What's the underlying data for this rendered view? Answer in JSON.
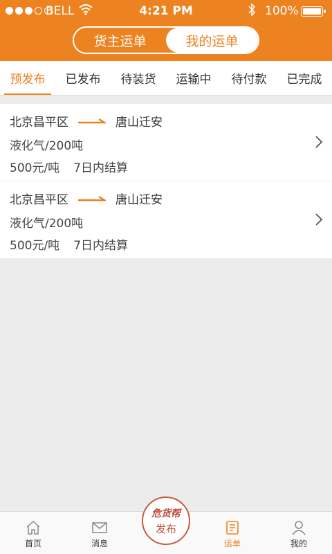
{
  "status_bar": {
    "carrier": "BELL",
    "time": "4:21 PM",
    "battery": "100%",
    "battery_level": 1.0
  },
  "header": {
    "segments": [
      {
        "label": "货主运单",
        "active": false
      },
      {
        "label": "我的运单",
        "active": true
      }
    ]
  },
  "tabs": [
    {
      "label": "预发布",
      "active": true
    },
    {
      "label": "已发布",
      "active": false
    },
    {
      "label": "待装货",
      "active": false
    },
    {
      "label": "运输中",
      "active": false
    },
    {
      "label": "待付款",
      "active": false
    },
    {
      "label": "已完成",
      "active": false
    }
  ],
  "orders": [
    {
      "from": "北京昌平区",
      "to": "唐山迁安",
      "cargo": "液化气/200吨",
      "price": "500元/吨",
      "settlement": "7日内结算"
    },
    {
      "from": "北京昌平区",
      "to": "唐山迁安",
      "cargo": "液化气/200吨",
      "price": "500元/吨",
      "settlement": "7日内结算"
    }
  ],
  "bottom_nav": {
    "home": "首页",
    "messages": "消息",
    "publish_logo": "危货帮",
    "publish": "发布",
    "waybill": "运单",
    "mine": "我的"
  },
  "colors": {
    "accent": "#ec8320",
    "publish_red": "#c04a3c",
    "background": "#ececec"
  }
}
